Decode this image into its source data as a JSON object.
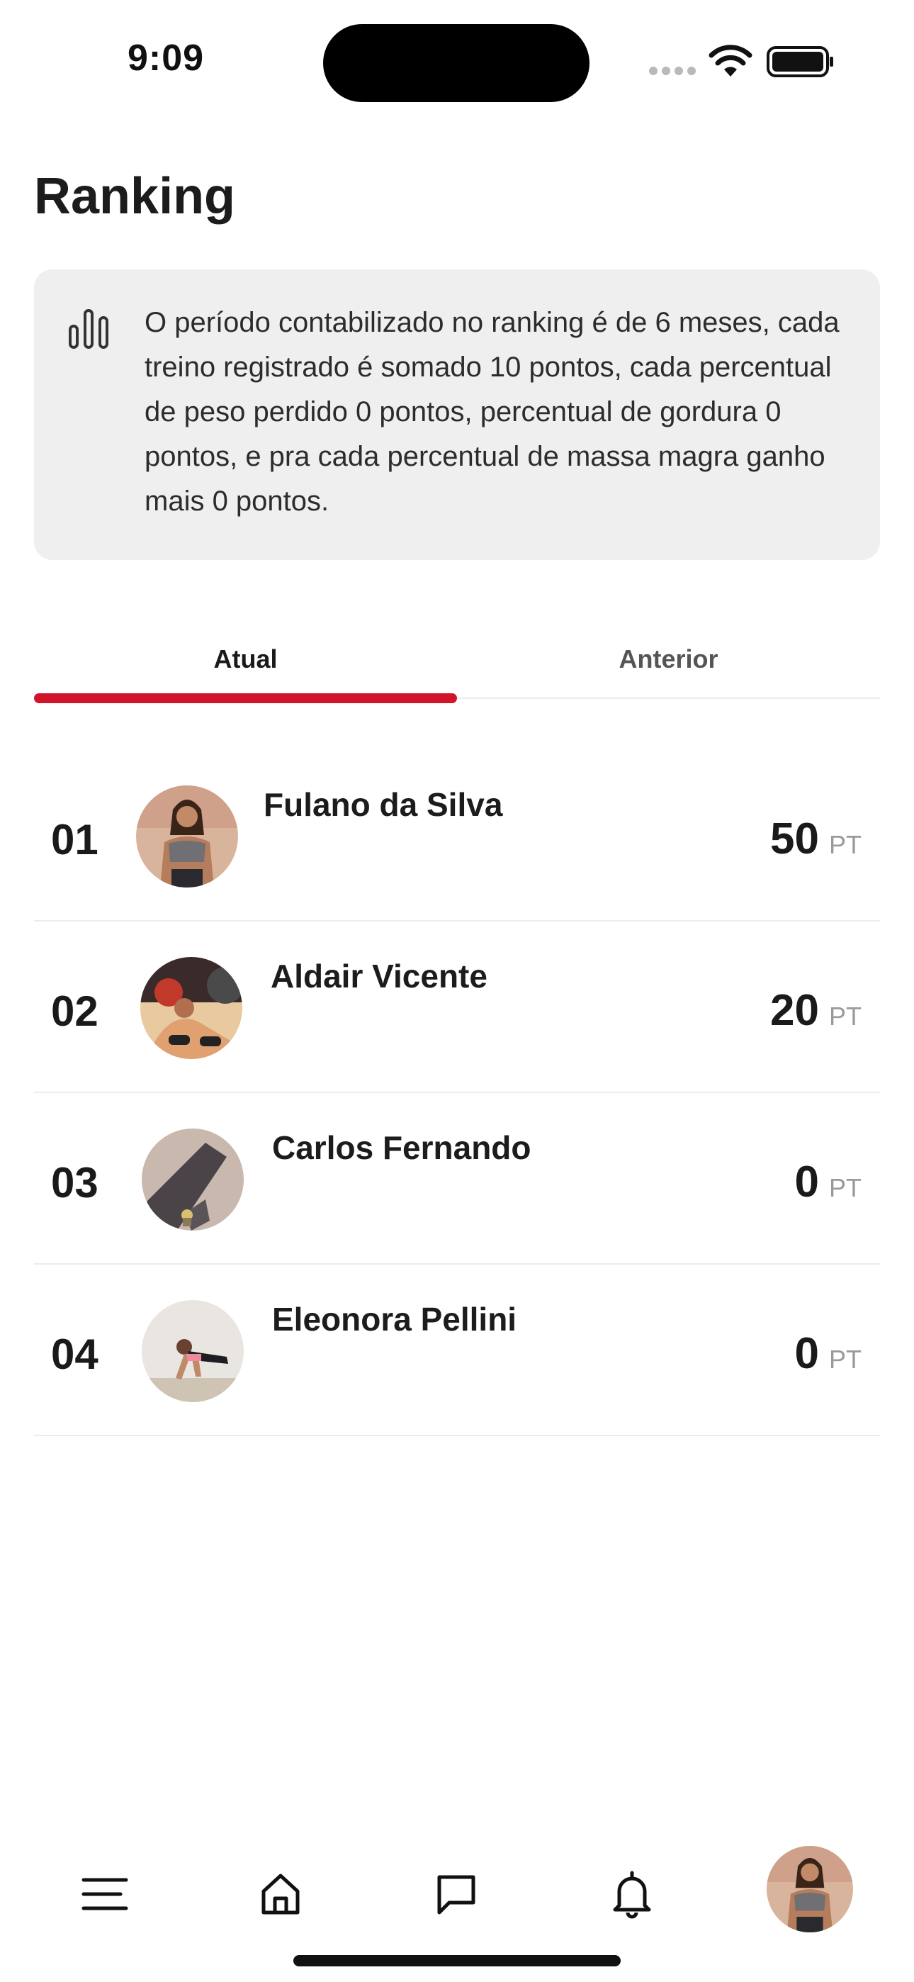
{
  "status_bar": {
    "time": "9:09"
  },
  "page": {
    "title": "Ranking"
  },
  "info_card": {
    "icon": "bar-chart-icon",
    "text": "O período contabilizado no ranking é de 6 meses, cada treino registrado é somado 10 pontos, cada percentual de peso perdido 0 pontos, percentual de gordura 0 pontos, e pra cada percentual de massa magra ganho mais 0 pontos."
  },
  "tabs": [
    {
      "label": "Atual",
      "active": true
    },
    {
      "label": "Anterior",
      "active": false
    }
  ],
  "ranking": [
    {
      "position": "01",
      "name": "Fulano da Silva",
      "points": "50",
      "unit": "PT"
    },
    {
      "position": "02",
      "name": "Aldair Vicente",
      "points": "20",
      "unit": "PT"
    },
    {
      "position": "03",
      "name": "Carlos Fernando",
      "points": "0",
      "unit": "PT"
    },
    {
      "position": "04",
      "name": "Eleonora Pellini",
      "points": "0",
      "unit": "PT"
    }
  ],
  "bottom_nav": {
    "items": [
      "menu-icon",
      "home-icon",
      "chat-icon",
      "bell-icon",
      "profile-avatar"
    ]
  },
  "colors": {
    "accent": "#d1142a",
    "card_background": "#efefef",
    "divider": "#ececec",
    "unit_text": "#9a9a9a"
  }
}
